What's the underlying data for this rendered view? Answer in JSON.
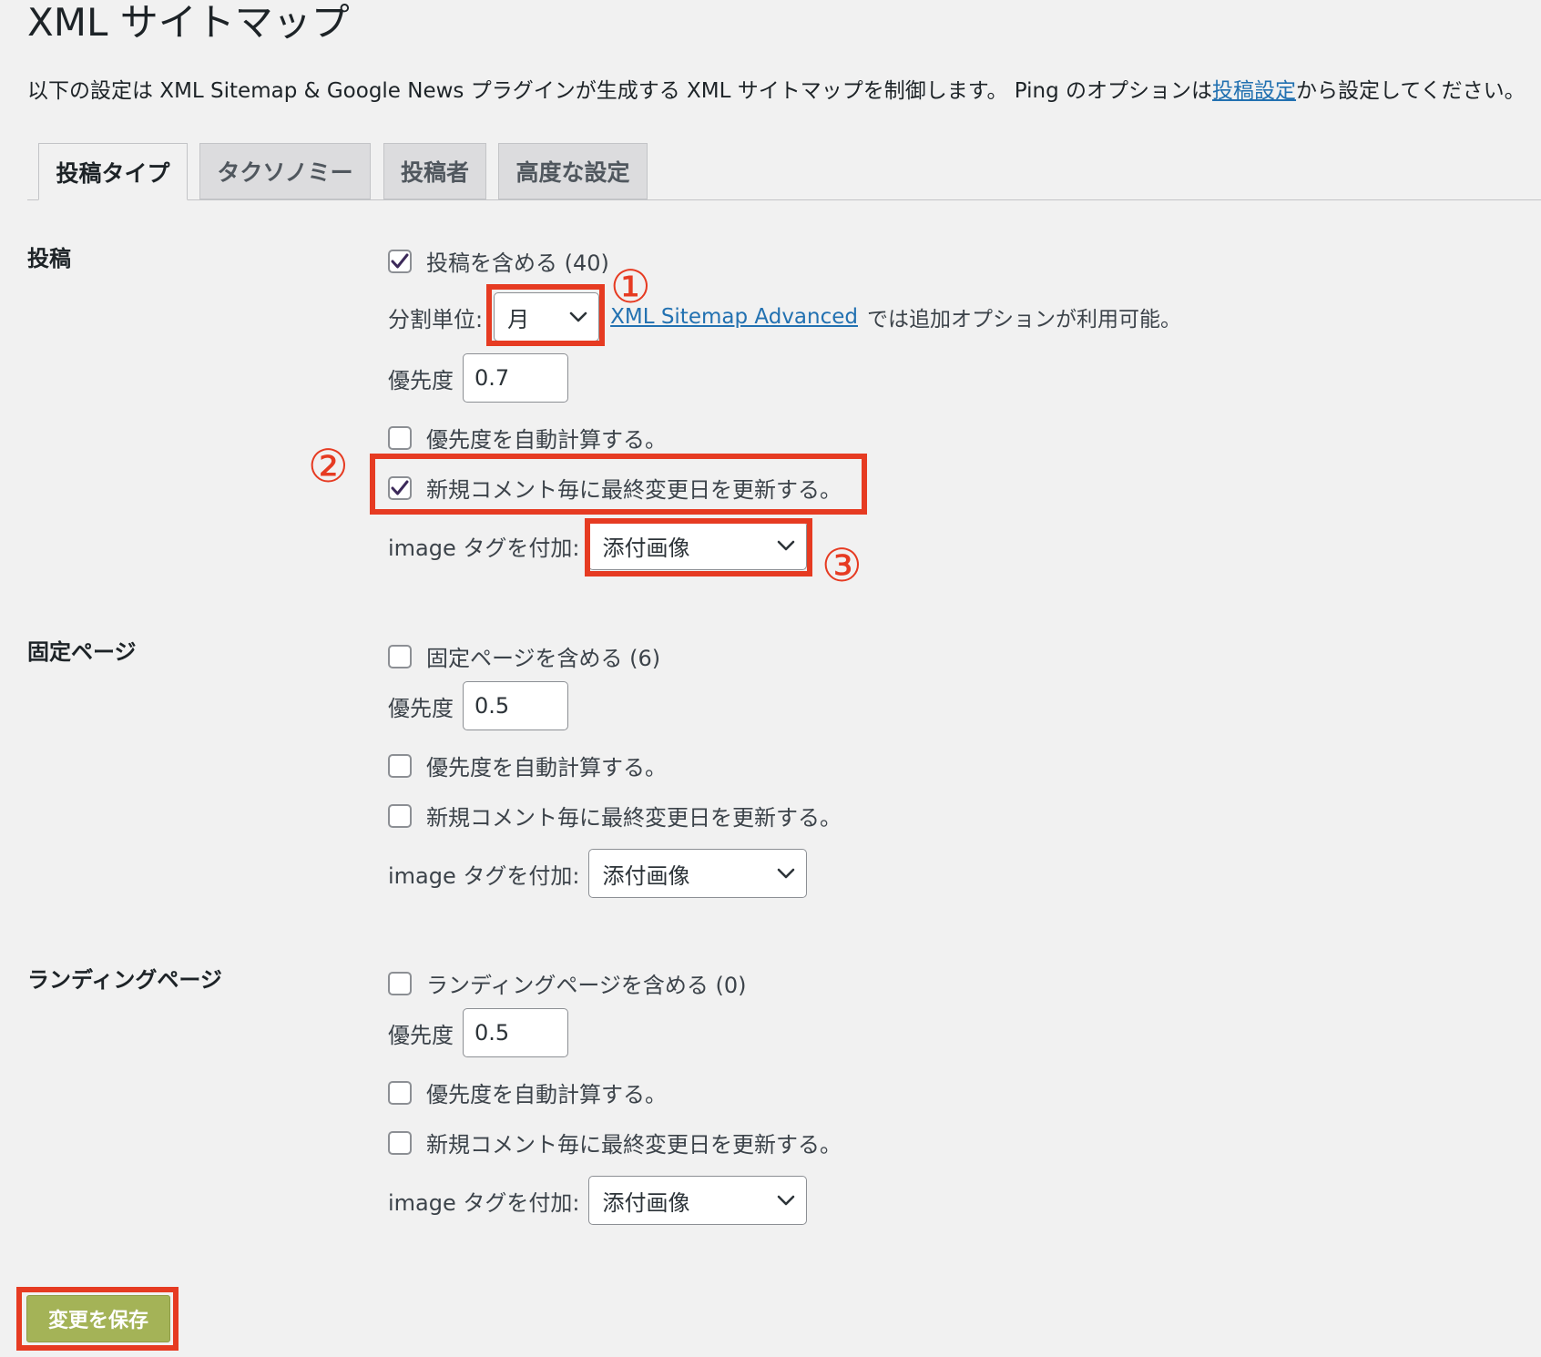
{
  "page": {
    "title": "XML サイトマップ",
    "intro_text": "以下の設定は XML Sitemap & Google News プラグインが生成する XML サイトマップを制御します。 Ping のオプションは",
    "intro_link": "投稿設定",
    "intro_suffix": "から設定してください。"
  },
  "tabs": [
    {
      "label": "投稿タイプ",
      "active": true
    },
    {
      "label": "タクソノミー",
      "active": false
    },
    {
      "label": "投稿者",
      "active": false
    },
    {
      "label": "高度な設定",
      "active": false
    }
  ],
  "sections": {
    "post": {
      "label": "投稿",
      "include": {
        "label": "投稿を含める (40)",
        "checked": true
      },
      "split_label": "分割単位:",
      "split_value": "月",
      "advanced_link": "XML Sitemap Advanced",
      "advanced_suffix": "では追加オプションが利用可能。",
      "priority_label": "優先度",
      "priority_value": "0.7",
      "auto_priority": {
        "label": "優先度を自動計算する。",
        "checked": false
      },
      "update_on_comment": {
        "label": "新規コメント毎に最終変更日を更新する。",
        "checked": true
      },
      "image_label": "image タグを付加:",
      "image_value": "添付画像"
    },
    "page": {
      "label": "固定ページ",
      "include": {
        "label": "固定ページを含める (6)",
        "checked": false
      },
      "priority_label": "優先度",
      "priority_value": "0.5",
      "auto_priority": {
        "label": "優先度を自動計算する。",
        "checked": false
      },
      "update_on_comment": {
        "label": "新規コメント毎に最終変更日を更新する。",
        "checked": false
      },
      "image_label": "image タグを付加:",
      "image_value": "添付画像"
    },
    "landing": {
      "label": "ランディングページ",
      "include": {
        "label": "ランディングページを含める (0)",
        "checked": false
      },
      "priority_label": "優先度",
      "priority_value": "0.5",
      "auto_priority": {
        "label": "優先度を自動計算する。",
        "checked": false
      },
      "update_on_comment": {
        "label": "新規コメント毎に最終変更日を更新する。",
        "checked": false
      },
      "image_label": "image タグを付加:",
      "image_value": "添付画像"
    }
  },
  "annotations": {
    "n1": "①",
    "n2": "②",
    "n3": "③"
  },
  "save_button": "変更を保存",
  "colors": {
    "accent_highlight": "#e63b22",
    "link": "#2271b1",
    "save_button": "#a4b357",
    "checkmark": "#3c2a5a"
  }
}
